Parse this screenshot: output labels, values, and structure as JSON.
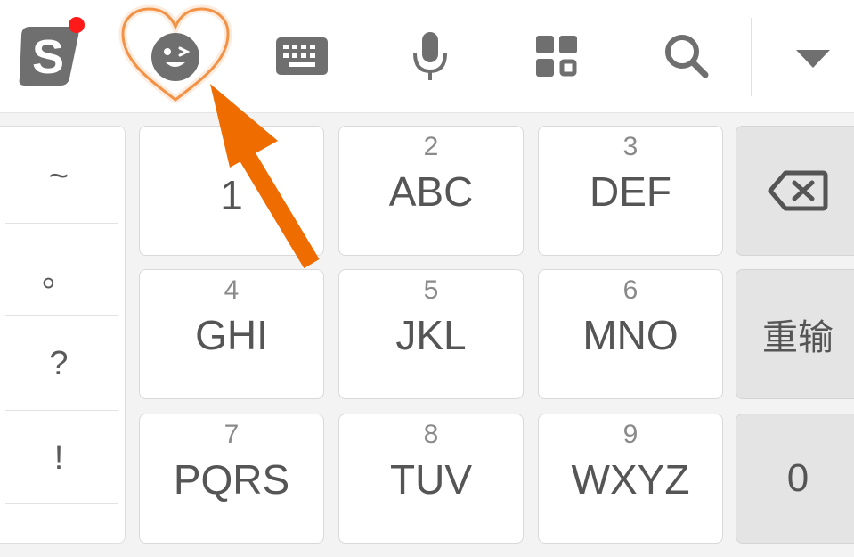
{
  "toolbar": {
    "items": [
      {
        "name": "sogou-logo-icon"
      },
      {
        "name": "emoji-icon"
      },
      {
        "name": "keyboard-icon"
      },
      {
        "name": "microphone-icon"
      },
      {
        "name": "grid-apps-icon"
      },
      {
        "name": "search-icon"
      },
      {
        "name": "collapse-keyboard-icon"
      }
    ],
    "notification_color": "#ff1a1a",
    "highlight_color": "#f07a1e"
  },
  "symbols": [
    "~",
    "。",
    "?",
    "!"
  ],
  "keys": [
    {
      "num": "",
      "letters": "1"
    },
    {
      "num": "2",
      "letters": "ABC"
    },
    {
      "num": "3",
      "letters": "DEF"
    },
    {
      "num": "4",
      "letters": "GHI"
    },
    {
      "num": "5",
      "letters": "JKL"
    },
    {
      "num": "6",
      "letters": "MNO"
    },
    {
      "num": "7",
      "letters": "PQRS"
    },
    {
      "num": "8",
      "letters": "TUV"
    },
    {
      "num": "9",
      "letters": "WXYZ"
    }
  ],
  "function_keys": {
    "delete": "backspace-icon",
    "reset_label": "重输",
    "zero_label": "0"
  }
}
